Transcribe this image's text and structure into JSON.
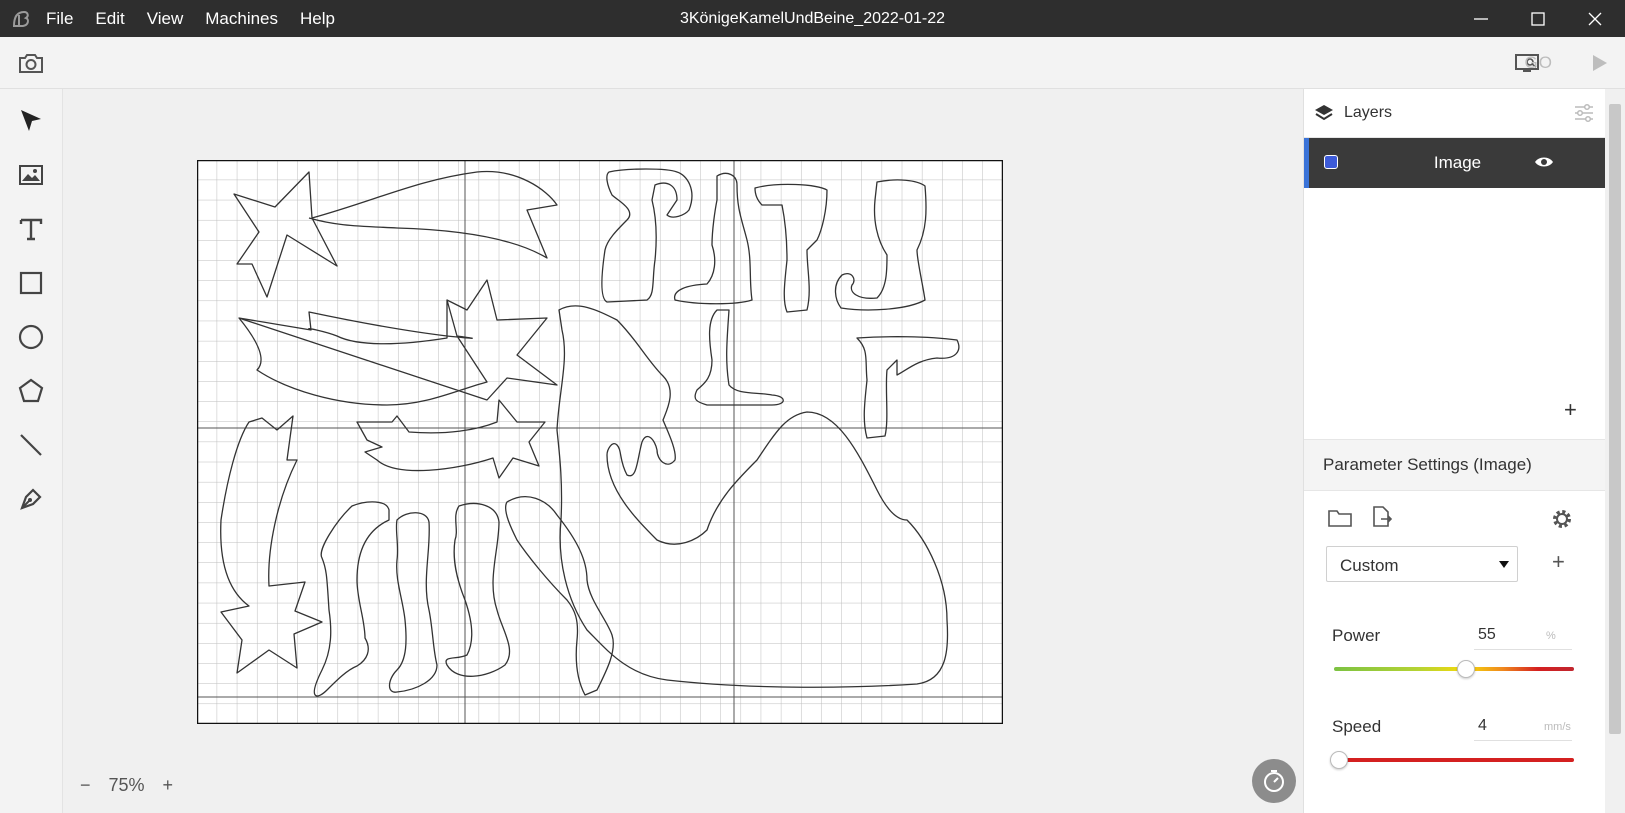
{
  "app": {
    "document_title": "3KönigeKamelUndBeine_2022-01-22",
    "logo_icon": "app-logo-icon"
  },
  "menu": [
    {
      "label": "File"
    },
    {
      "label": "Edit"
    },
    {
      "label": "View"
    },
    {
      "label": "Machines"
    },
    {
      "label": "Help"
    }
  ],
  "window_controls": [
    "minimize-icon",
    "maximize-icon",
    "close-icon"
  ],
  "toolbar": {
    "camera_icon": "camera-icon",
    "preview_icon": "monitor-search-icon",
    "go_label": "GO",
    "play_icon": "play-icon"
  },
  "tools": [
    {
      "name": "select-tool",
      "icon": "cursor-arrow-icon"
    },
    {
      "name": "image-tool",
      "icon": "image-icon"
    },
    {
      "name": "text-tool",
      "icon": "text-icon"
    },
    {
      "name": "rectangle-tool",
      "icon": "square-icon"
    },
    {
      "name": "ellipse-tool",
      "icon": "circle-icon"
    },
    {
      "name": "polygon-tool",
      "icon": "pentagon-icon"
    },
    {
      "name": "line-tool",
      "icon": "line-icon"
    },
    {
      "name": "pen-tool",
      "icon": "pen-nib-icon"
    }
  ],
  "canvas": {
    "zoom_label": "75%",
    "zoom_minus": "−",
    "zoom_plus": "+",
    "timer_icon": "timer-icon"
  },
  "layers": {
    "title": "Layers",
    "items": [
      {
        "name": "Image",
        "color": "#3d5bd8",
        "visible": true
      }
    ],
    "add_label": "+"
  },
  "parameters": {
    "title": "Parameter Settings (Image)",
    "preset": "Custom",
    "add_preset_label": "+",
    "power": {
      "label": "Power",
      "value": "55",
      "unit": "%",
      "fraction": 0.55
    },
    "speed": {
      "label": "Speed",
      "value": "4",
      "unit": "mm/s",
      "fraction": 0.02
    }
  },
  "colors": {
    "titlebar": "#2e2e2e",
    "layer_selected_bg": "#3a3a3a",
    "layer_accent": "#3a73d8",
    "speed_track": "#d42020"
  }
}
